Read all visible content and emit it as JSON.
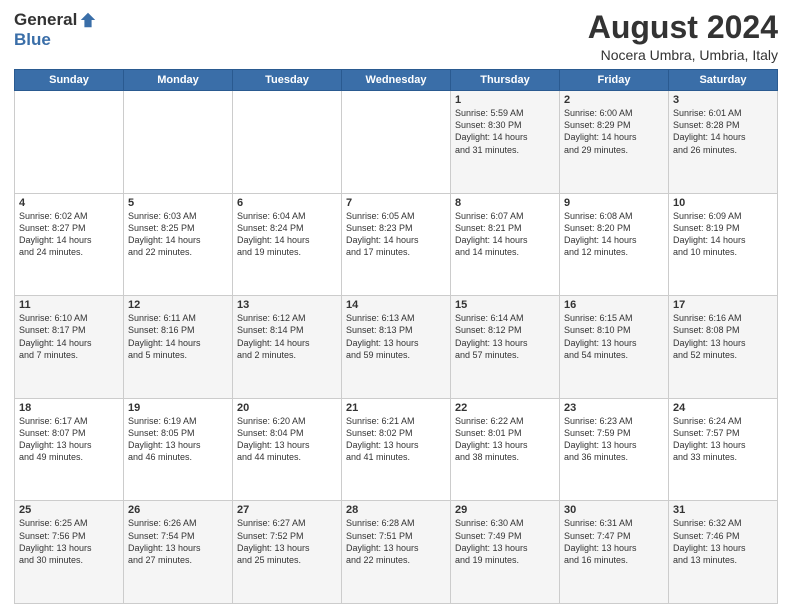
{
  "logo": {
    "general": "General",
    "blue": "Blue"
  },
  "title": "August 2024",
  "subtitle": "Nocera Umbra, Umbria, Italy",
  "header_days": [
    "Sunday",
    "Monday",
    "Tuesday",
    "Wednesday",
    "Thursday",
    "Friday",
    "Saturday"
  ],
  "weeks": [
    [
      {
        "day": "",
        "info": ""
      },
      {
        "day": "",
        "info": ""
      },
      {
        "day": "",
        "info": ""
      },
      {
        "day": "",
        "info": ""
      },
      {
        "day": "1",
        "info": "Sunrise: 5:59 AM\nSunset: 8:30 PM\nDaylight: 14 hours\nand 31 minutes."
      },
      {
        "day": "2",
        "info": "Sunrise: 6:00 AM\nSunset: 8:29 PM\nDaylight: 14 hours\nand 29 minutes."
      },
      {
        "day": "3",
        "info": "Sunrise: 6:01 AM\nSunset: 8:28 PM\nDaylight: 14 hours\nand 26 minutes."
      }
    ],
    [
      {
        "day": "4",
        "info": "Sunrise: 6:02 AM\nSunset: 8:27 PM\nDaylight: 14 hours\nand 24 minutes."
      },
      {
        "day": "5",
        "info": "Sunrise: 6:03 AM\nSunset: 8:25 PM\nDaylight: 14 hours\nand 22 minutes."
      },
      {
        "day": "6",
        "info": "Sunrise: 6:04 AM\nSunset: 8:24 PM\nDaylight: 14 hours\nand 19 minutes."
      },
      {
        "day": "7",
        "info": "Sunrise: 6:05 AM\nSunset: 8:23 PM\nDaylight: 14 hours\nand 17 minutes."
      },
      {
        "day": "8",
        "info": "Sunrise: 6:07 AM\nSunset: 8:21 PM\nDaylight: 14 hours\nand 14 minutes."
      },
      {
        "day": "9",
        "info": "Sunrise: 6:08 AM\nSunset: 8:20 PM\nDaylight: 14 hours\nand 12 minutes."
      },
      {
        "day": "10",
        "info": "Sunrise: 6:09 AM\nSunset: 8:19 PM\nDaylight: 14 hours\nand 10 minutes."
      }
    ],
    [
      {
        "day": "11",
        "info": "Sunrise: 6:10 AM\nSunset: 8:17 PM\nDaylight: 14 hours\nand 7 minutes."
      },
      {
        "day": "12",
        "info": "Sunrise: 6:11 AM\nSunset: 8:16 PM\nDaylight: 14 hours\nand 5 minutes."
      },
      {
        "day": "13",
        "info": "Sunrise: 6:12 AM\nSunset: 8:14 PM\nDaylight: 14 hours\nand 2 minutes."
      },
      {
        "day": "14",
        "info": "Sunrise: 6:13 AM\nSunset: 8:13 PM\nDaylight: 13 hours\nand 59 minutes."
      },
      {
        "day": "15",
        "info": "Sunrise: 6:14 AM\nSunset: 8:12 PM\nDaylight: 13 hours\nand 57 minutes."
      },
      {
        "day": "16",
        "info": "Sunrise: 6:15 AM\nSunset: 8:10 PM\nDaylight: 13 hours\nand 54 minutes."
      },
      {
        "day": "17",
        "info": "Sunrise: 6:16 AM\nSunset: 8:08 PM\nDaylight: 13 hours\nand 52 minutes."
      }
    ],
    [
      {
        "day": "18",
        "info": "Sunrise: 6:17 AM\nSunset: 8:07 PM\nDaylight: 13 hours\nand 49 minutes."
      },
      {
        "day": "19",
        "info": "Sunrise: 6:19 AM\nSunset: 8:05 PM\nDaylight: 13 hours\nand 46 minutes."
      },
      {
        "day": "20",
        "info": "Sunrise: 6:20 AM\nSunset: 8:04 PM\nDaylight: 13 hours\nand 44 minutes."
      },
      {
        "day": "21",
        "info": "Sunrise: 6:21 AM\nSunset: 8:02 PM\nDaylight: 13 hours\nand 41 minutes."
      },
      {
        "day": "22",
        "info": "Sunrise: 6:22 AM\nSunset: 8:01 PM\nDaylight: 13 hours\nand 38 minutes."
      },
      {
        "day": "23",
        "info": "Sunrise: 6:23 AM\nSunset: 7:59 PM\nDaylight: 13 hours\nand 36 minutes."
      },
      {
        "day": "24",
        "info": "Sunrise: 6:24 AM\nSunset: 7:57 PM\nDaylight: 13 hours\nand 33 minutes."
      }
    ],
    [
      {
        "day": "25",
        "info": "Sunrise: 6:25 AM\nSunset: 7:56 PM\nDaylight: 13 hours\nand 30 minutes."
      },
      {
        "day": "26",
        "info": "Sunrise: 6:26 AM\nSunset: 7:54 PM\nDaylight: 13 hours\nand 27 minutes."
      },
      {
        "day": "27",
        "info": "Sunrise: 6:27 AM\nSunset: 7:52 PM\nDaylight: 13 hours\nand 25 minutes."
      },
      {
        "day": "28",
        "info": "Sunrise: 6:28 AM\nSunset: 7:51 PM\nDaylight: 13 hours\nand 22 minutes."
      },
      {
        "day": "29",
        "info": "Sunrise: 6:30 AM\nSunset: 7:49 PM\nDaylight: 13 hours\nand 19 minutes."
      },
      {
        "day": "30",
        "info": "Sunrise: 6:31 AM\nSunset: 7:47 PM\nDaylight: 13 hours\nand 16 minutes."
      },
      {
        "day": "31",
        "info": "Sunrise: 6:32 AM\nSunset: 7:46 PM\nDaylight: 13 hours\nand 13 minutes."
      }
    ]
  ]
}
